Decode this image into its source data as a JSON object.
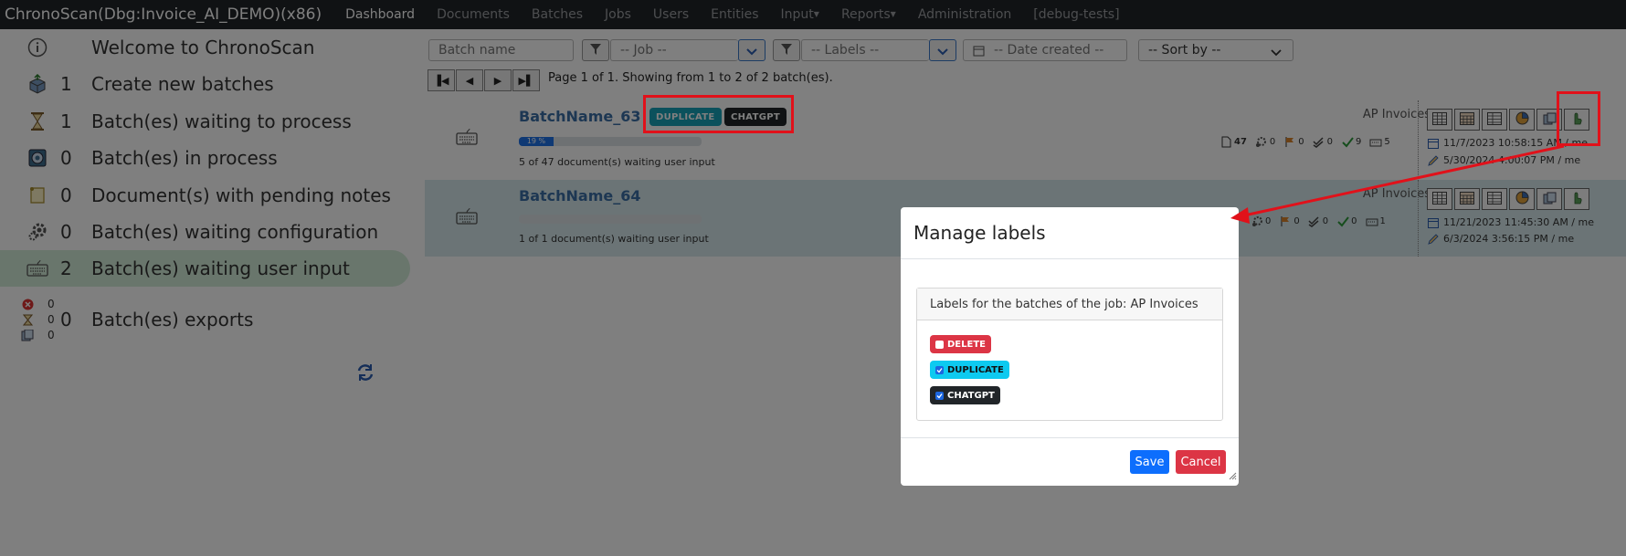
{
  "app": {
    "title": "ChronoScan(Dbg:Invoice_AI_DEMO)(x86)",
    "nav": [
      "Dashboard",
      "Documents",
      "Batches",
      "Jobs",
      "Users",
      "Entities",
      "Input",
      "Reports",
      "Administration",
      "[debug-tests]"
    ],
    "nav_active": "Dashboard",
    "nav_dropdowns": [
      "Input",
      "Reports"
    ]
  },
  "sidebar": {
    "welcome": "Welcome to ChronoScan",
    "items": [
      {
        "count": "1",
        "label": "Create new batches",
        "icon": "create-batch-icon"
      },
      {
        "count": "1",
        "label": "Batch(es) waiting to process",
        "icon": "hourglass-icon"
      },
      {
        "count": "0",
        "label": "Batch(es) in process",
        "icon": "process-icon"
      },
      {
        "count": "0",
        "label": "Document(s) with pending notes",
        "icon": "note-icon"
      },
      {
        "count": "0",
        "label": "Batch(es) waiting configuration",
        "icon": "gear-icon"
      },
      {
        "count": "2",
        "label": "Batch(es) waiting user input",
        "icon": "keyboard-icon"
      }
    ],
    "exports": {
      "count": "0",
      "label": "Batch(es) exports",
      "errors": "0",
      "waiting": "0",
      "done": "0"
    }
  },
  "filters": {
    "batch_name_placeholder": "Batch name",
    "job": "-- Job --",
    "labels": "-- Labels --",
    "date_created": "-- Date created --",
    "sort_by": "-- Sort by --"
  },
  "pagination": {
    "info": "Page 1 of 1. Showing from 1 to 2 of 2 batch(es)."
  },
  "batches": [
    {
      "name": "BatchName_63",
      "tags": [
        "DUPLICATE",
        "CHATGPT"
      ],
      "progress_text": "19 %",
      "progress": 0.19,
      "status": "5 of 47 document(s) waiting user input",
      "job": "AP Invoices",
      "stats": {
        "docs": "47",
        "config": "0",
        "flags": "0",
        "checked": "0",
        "ok": "9",
        "input": "5"
      },
      "created": "11/7/2023 10:58:15 AM / me",
      "modified": "5/30/2024 4:00:07 PM / me"
    },
    {
      "name": "BatchName_64",
      "tags": [],
      "progress_text": "",
      "progress": 0,
      "status": "1 of 1 document(s) waiting user input",
      "job": "AP Invoices",
      "stats": {
        "config": "0",
        "flags": "0",
        "checked": "0",
        "ok": "0",
        "input": "1"
      },
      "created": "11/21/2023 11:45:30 AM / me",
      "modified": "6/3/2024 3:56:15 PM / me"
    }
  ],
  "modal": {
    "title": "Manage labels",
    "card_header": "Labels for the batches of the job: AP Invoices",
    "labels": [
      {
        "name": "DELETE",
        "checked": false,
        "color": "#dc3545"
      },
      {
        "name": "DUPLICATE",
        "checked": true,
        "color": "#0dcaf0"
      },
      {
        "name": "CHATGPT",
        "checked": true,
        "color": "#212529"
      }
    ],
    "save": "Save",
    "cancel": "Cancel"
  },
  "colors": {
    "accent_blue": "#0d6efd",
    "danger_red": "#dc3545",
    "annotation_red": "#e1111a",
    "active_sidebar": "#d3ecd9"
  }
}
